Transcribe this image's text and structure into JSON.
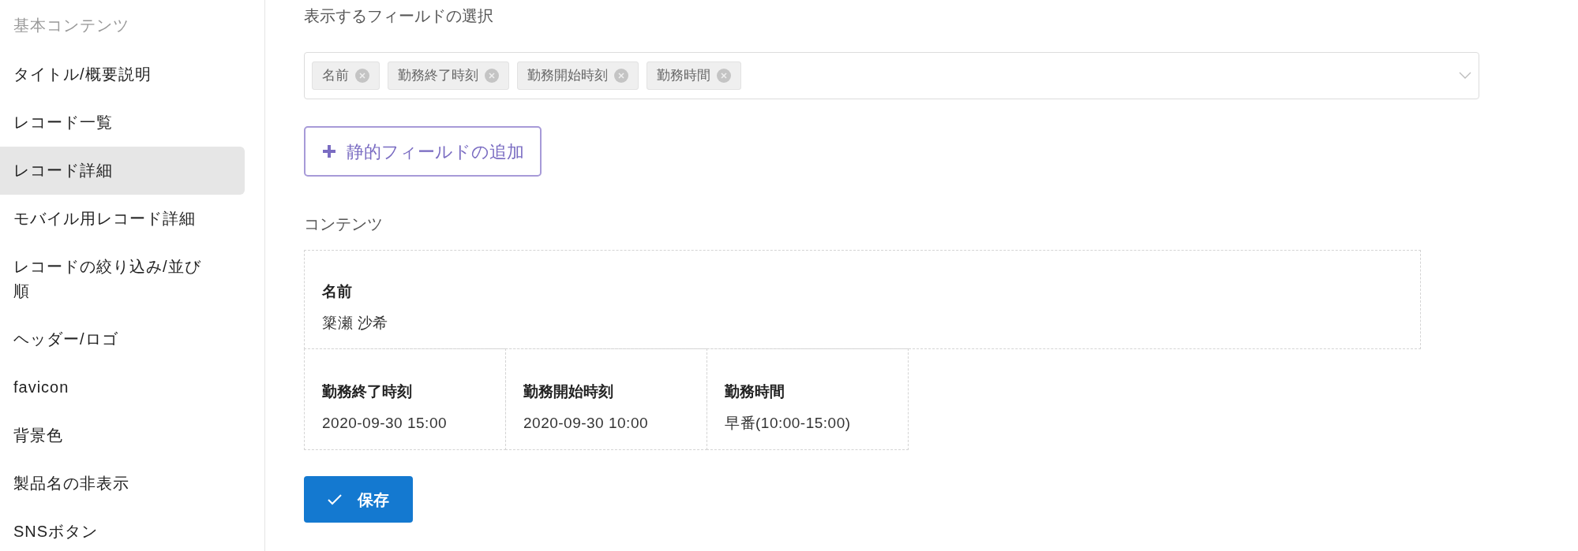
{
  "sidebar": {
    "header": "基本コンテンツ",
    "items": [
      {
        "label": "タイトル/概要説明",
        "selected": false
      },
      {
        "label": "レコード一覧",
        "selected": false
      },
      {
        "label": "レコード詳細",
        "selected": true
      },
      {
        "label": "モバイル用レコード詳細",
        "selected": false
      },
      {
        "label": "レコードの絞り込み/並び順",
        "selected": false
      },
      {
        "label": "ヘッダー/ロゴ",
        "selected": false
      },
      {
        "label": "favicon",
        "selected": false
      },
      {
        "label": "背景色",
        "selected": false
      },
      {
        "label": "製品名の非表示",
        "selected": false
      },
      {
        "label": "SNSボタン",
        "selected": false
      }
    ]
  },
  "field_select": {
    "label": "表示するフィールドの選択",
    "tags": [
      "名前",
      "勤務終了時刻",
      "勤務開始時刻",
      "勤務時間"
    ]
  },
  "add_button": {
    "label": "静的フィールドの追加"
  },
  "content": {
    "label": "コンテンツ",
    "rows": [
      [
        {
          "label": "名前",
          "value": "簗瀬 沙希"
        }
      ],
      [
        {
          "label": "勤務終了時刻",
          "value": "2020-09-30 15:00"
        },
        {
          "label": "勤務開始時刻",
          "value": "2020-09-30 10:00"
        },
        {
          "label": "勤務時間",
          "value": "早番(10:00-15:00)"
        }
      ]
    ]
  },
  "save_button": {
    "label": "保存"
  }
}
